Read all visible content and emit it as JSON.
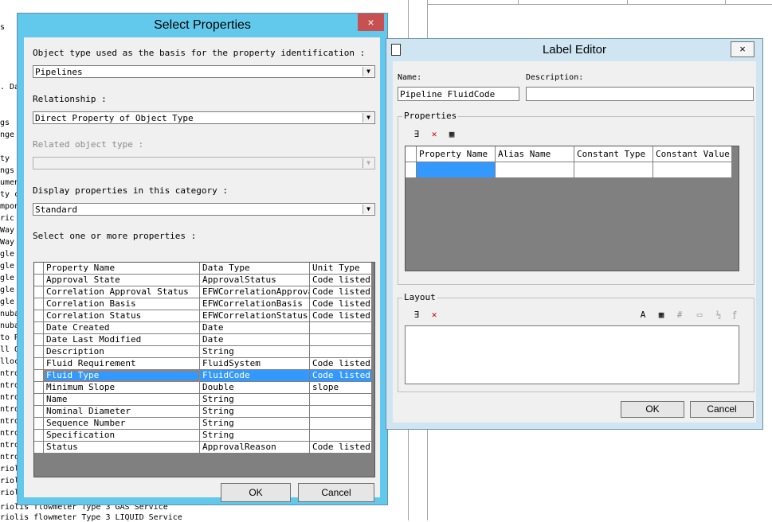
{
  "background": {
    "left_text": [
      "s",
      "",
      "",
      "",
      "",
      ". Da",
      "",
      "",
      "gs",
      "nge",
      "",
      "ty",
      "ngs",
      "umen",
      "ty c",
      "mpon",
      "ric",
      "Way",
      "Way",
      "gle",
      "gle",
      "gle",
      "gle",
      "gle",
      "nuba",
      "nuba",
      "to R",
      "ll O",
      "lloc",
      "ntro",
      "ntro",
      "ntro",
      "ntro",
      "ntro",
      "ntro",
      "ntro",
      "ntro",
      "riol",
      "riol",
      "riol"
    ],
    "bottom_text": [
      "riolis flowmeter Type 3 GAS Service",
      "riolis flowmeter Type 3 LIQUID Service"
    ]
  },
  "select_properties": {
    "title": "Select Properties",
    "close": "×",
    "object_type_label": "Object type used as the basis for the property identification :",
    "object_type_value": "Pipelines",
    "relationship_label": "Relationship :",
    "relationship_value": "Direct Property of Object Type",
    "related_label": "Related object type :",
    "related_value": "",
    "category_label": "Display properties in this category :",
    "category_value": "Standard",
    "select_label": "Select one or more properties :",
    "columns": [
      "Property Name",
      "Data Type",
      "Unit Type"
    ],
    "rows": [
      [
        "Approval State",
        "ApprovalStatus",
        "Code listed"
      ],
      [
        "Correlation Approval Status",
        "EFWCorrelationApproval",
        "Code listed"
      ],
      [
        "Correlation Basis",
        "EFWCorrelationBasis",
        "Code listed"
      ],
      [
        "Correlation Status",
        "EFWCorrelationStatus",
        "Code listed"
      ],
      [
        "Date Created",
        "Date",
        ""
      ],
      [
        "Date Last Modified",
        "Date",
        ""
      ],
      [
        "Description",
        "String",
        ""
      ],
      [
        "Fluid Requirement",
        "FluidSystem",
        "Code listed"
      ],
      [
        "Fluid Type",
        "FluidCode",
        "Code listed"
      ],
      [
        "Minimum Slope",
        "Double",
        "slope"
      ],
      [
        "Name",
        "String",
        ""
      ],
      [
        "Nominal Diameter",
        "String",
        ""
      ],
      [
        "Sequence Number",
        "String",
        ""
      ],
      [
        "Specification",
        "String",
        ""
      ],
      [
        "Status",
        "ApprovalReason",
        "Code listed"
      ]
    ],
    "selected_row": 8,
    "ok": "OK",
    "cancel": "Cancel"
  },
  "label_editor": {
    "title": "Label Editor",
    "close": "×",
    "name_label": "Name:",
    "name_value": "Pipeline FluidCode",
    "description_label": "Description:",
    "description_value": "",
    "properties_group": "Properties",
    "columns": [
      "Property Name",
      "Alias Name",
      "Constant Type",
      "Constant Value"
    ],
    "layout_group": "Layout",
    "ok": "OK",
    "cancel": "Cancel"
  }
}
